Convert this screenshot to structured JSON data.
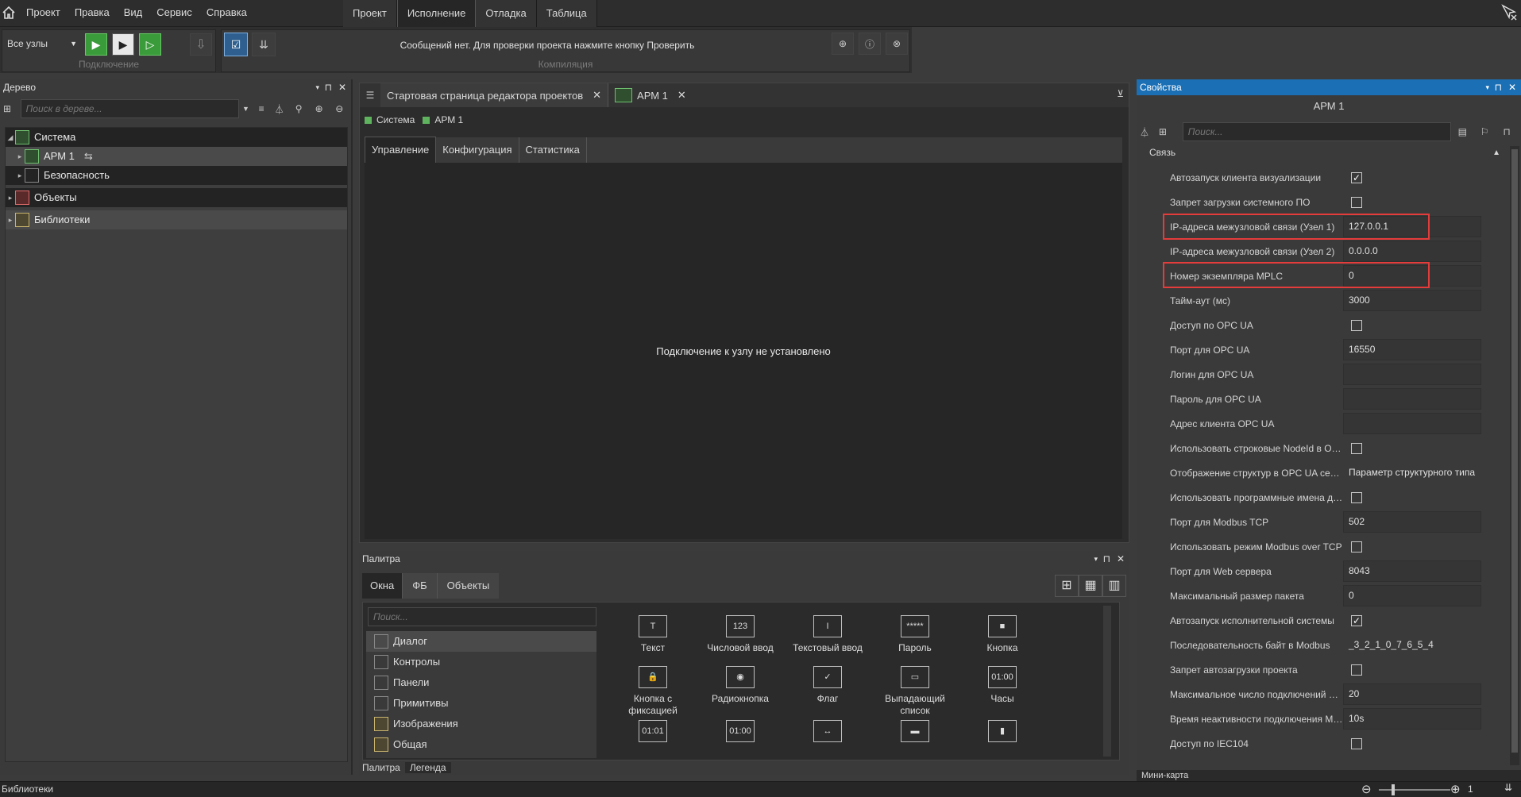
{
  "menu": {
    "items": [
      "Проект",
      "Правка",
      "Вид",
      "Сервис",
      "Справка"
    ]
  },
  "mode_tabs": [
    "Проект",
    "Исполнение",
    "Отладка",
    "Таблица"
  ],
  "toolbar": {
    "nodes_select": "Все узлы",
    "group_connect": "Подключение",
    "group_compile": "Компиляция",
    "message": "Сообщений нет. Для проверки проекта нажмите кнопку Проверить"
  },
  "tree": {
    "title": "Дерево",
    "search_placeholder": "Поиск в дереве...",
    "nodes": [
      {
        "label": "Система"
      },
      {
        "label": "АРМ 1"
      },
      {
        "label": "Безопасность"
      },
      {
        "label": "Объекты"
      },
      {
        "label": "Библиотеки"
      }
    ]
  },
  "editor": {
    "tabs": [
      "Стартовая страница редактора проектов",
      "АРМ 1"
    ],
    "breadcrumb": [
      "Система",
      "АРМ 1"
    ],
    "subtabs": [
      "Управление",
      "Конфигурация",
      "Статистика"
    ],
    "message": "Подключение к узлу не установлено"
  },
  "palette": {
    "title": "Палитра",
    "tabs": [
      "Окна",
      "ФБ",
      "Объекты"
    ],
    "search_placeholder": "Поиск...",
    "list": [
      "Диалог",
      "Контролы",
      "Панели",
      "Примитивы",
      "Изображения",
      "Общая"
    ],
    "items": [
      {
        "label": "Текст",
        "glyph": "T"
      },
      {
        "label": "Числовой ввод",
        "glyph": "123"
      },
      {
        "label": "Текстовый ввод",
        "glyph": "I"
      },
      {
        "label": "Пароль",
        "glyph": "*****"
      },
      {
        "label": "Кнопка",
        "glyph": "■"
      },
      {
        "label": "Кнопка с фиксацией",
        "glyph": "🔒"
      },
      {
        "label": "Радиокнопка",
        "glyph": "◉"
      },
      {
        "label": "Флаг",
        "glyph": "✓"
      },
      {
        "label": "Выпадающий список",
        "glyph": "▭"
      },
      {
        "label": "Часы",
        "glyph": "01:00"
      },
      {
        "label": "",
        "glyph": "01:01"
      },
      {
        "label": "",
        "glyph": "01:00"
      },
      {
        "label": "",
        "glyph": "↔"
      },
      {
        "label": "",
        "glyph": "▬"
      },
      {
        "label": "",
        "glyph": "▮"
      }
    ],
    "bottom_tabs": [
      "Палитра",
      "Легенда"
    ]
  },
  "properties": {
    "title": "Свойства",
    "object": "АРМ 1",
    "search_placeholder": "Поиск...",
    "section": "Связь",
    "rows": [
      {
        "name": "Автозапуск клиента визуализации",
        "type": "check",
        "checked": true
      },
      {
        "name": "Запрет загрузки системного ПО",
        "type": "check",
        "checked": false
      },
      {
        "name": "IP-адреса межузловой связи (Узел 1)",
        "type": "text",
        "value": "127.0.0.1"
      },
      {
        "name": "IP-адреса межузловой связи (Узел 2)",
        "type": "text",
        "value": "0.0.0.0"
      },
      {
        "name": "Номер экземпляра MPLC",
        "type": "text",
        "value": "0"
      },
      {
        "name": "Тайм-аут (мс)",
        "type": "text",
        "value": "3000"
      },
      {
        "name": "Доступ по OPC UA",
        "type": "check",
        "checked": false
      },
      {
        "name": "Порт для OPC UA",
        "type": "text",
        "value": "16550"
      },
      {
        "name": "Логин для OPC UA",
        "type": "text",
        "value": ""
      },
      {
        "name": "Пароль для OPC UA",
        "type": "text",
        "value": ""
      },
      {
        "name": "Адрес клиента OPC UA",
        "type": "text",
        "value": ""
      },
      {
        "name": "Использовать строковые NodeId в OPC...",
        "type": "check",
        "checked": false
      },
      {
        "name": "Отображение структур в OPC UA сервере",
        "type": "plain",
        "value": "Параметр структурного типа"
      },
      {
        "name": "Использовать программные имена для...",
        "type": "check",
        "checked": false
      },
      {
        "name": "Порт для Modbus TCP",
        "type": "text",
        "value": "502"
      },
      {
        "name": "Использовать режим Modbus over TCP",
        "type": "check",
        "checked": false
      },
      {
        "name": "Порт для Web сервера",
        "type": "text",
        "value": "8043"
      },
      {
        "name": "Максимальный размер пакета",
        "type": "text",
        "value": "0"
      },
      {
        "name": "Автозапуск исполнительной системы",
        "type": "check",
        "checked": true
      },
      {
        "name": "Последовательность байт в Modbus",
        "type": "plain",
        "value": "_3_2_1_0_7_6_5_4"
      },
      {
        "name": "Запрет автозагрузки проекта",
        "type": "check",
        "checked": false
      },
      {
        "name": "Максимальное число подключений Mo...",
        "type": "text",
        "value": "20"
      },
      {
        "name": "Время неактивности подключения Mod...",
        "type": "text",
        "value": "10s"
      },
      {
        "name": "Доступ по IEC104",
        "type": "check",
        "checked": false
      }
    ]
  },
  "minimap": {
    "title": "Мини-карта"
  },
  "statusbar": {
    "left": "Библиотеки",
    "zoom": "1"
  }
}
